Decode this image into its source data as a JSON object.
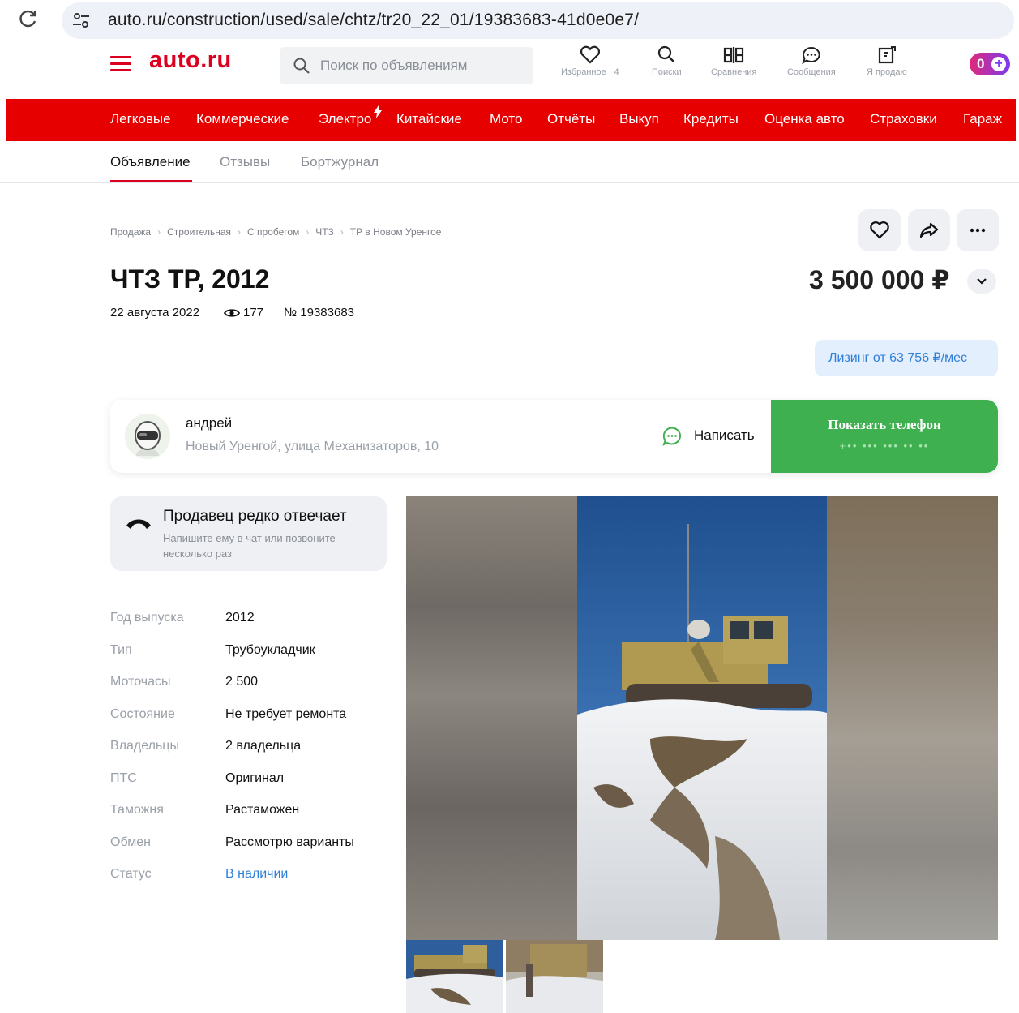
{
  "browser": {
    "url": "auto.ru/construction/used/sale/chtz/tr20_22_01/19383683-41d0e0e7/"
  },
  "header": {
    "logo": "auto.ru",
    "search_placeholder": "Поиск по объявлениям",
    "items": [
      {
        "label": "Избранное · 4",
        "icon": "heart-icon"
      },
      {
        "label": "Поиски",
        "icon": "saved-search-icon"
      },
      {
        "label": "Сравнения",
        "icon": "compare-icon"
      },
      {
        "label": "Сообщения",
        "icon": "chat-icon"
      },
      {
        "label": "Я продаю",
        "icon": "sell-icon"
      }
    ],
    "wallet_badge": "0"
  },
  "nav": {
    "items": [
      "Легковые",
      "Коммерческие",
      "Электро",
      "Китайские",
      "Мото",
      "Отчёты",
      "Выкуп",
      "Кредиты",
      "Оценка авто",
      "Страховки",
      "Гараж"
    ]
  },
  "tabs": {
    "items": [
      "Объявление",
      "Отзывы",
      "Бортжурнал"
    ],
    "active": "Объявление"
  },
  "breadcrumbs": [
    "Продажа",
    "Строительная",
    "С пробегом",
    "ЧТЗ",
    "ТР в Новом Уренгое"
  ],
  "listing": {
    "title": "ЧТЗ ТР, 2012",
    "price": "3 500 000 ₽",
    "date": "22 августа 2022",
    "views": "177",
    "number": "№ 19383683",
    "leasing": "Лизинг от 63 756 ₽/мес"
  },
  "seller": {
    "name": "андрей",
    "address": "Новый Уренгой, улица Механизаторов, 10",
    "write_label": "Написать",
    "phone_button": "Показать телефон",
    "phone_mask": "+•• ••• ••• •• ••"
  },
  "notice": {
    "title": "Продавец редко отвечает",
    "text": "Напишите ему в чат или позвоните несколько раз"
  },
  "specs": [
    {
      "key": "Год выпуска",
      "value": "2012"
    },
    {
      "key": "Тип",
      "value": "Трубоукладчик"
    },
    {
      "key": "Моточасы",
      "value": "2 500"
    },
    {
      "key": "Состояние",
      "value": "Не требует ремонта"
    },
    {
      "key": "Владельцы",
      "value": "2 владельца"
    },
    {
      "key": "ПТС",
      "value": "Оригинал"
    },
    {
      "key": "Таможня",
      "value": "Растаможен"
    },
    {
      "key": "Обмен",
      "value": "Рассмотрю варианты"
    },
    {
      "key": "Статус",
      "value": "В наличии"
    }
  ],
  "colors": {
    "brand_red": "#db0020",
    "nav_red": "#e60000",
    "phone_green": "#3fb04f",
    "link_blue": "#2f7fd8"
  }
}
